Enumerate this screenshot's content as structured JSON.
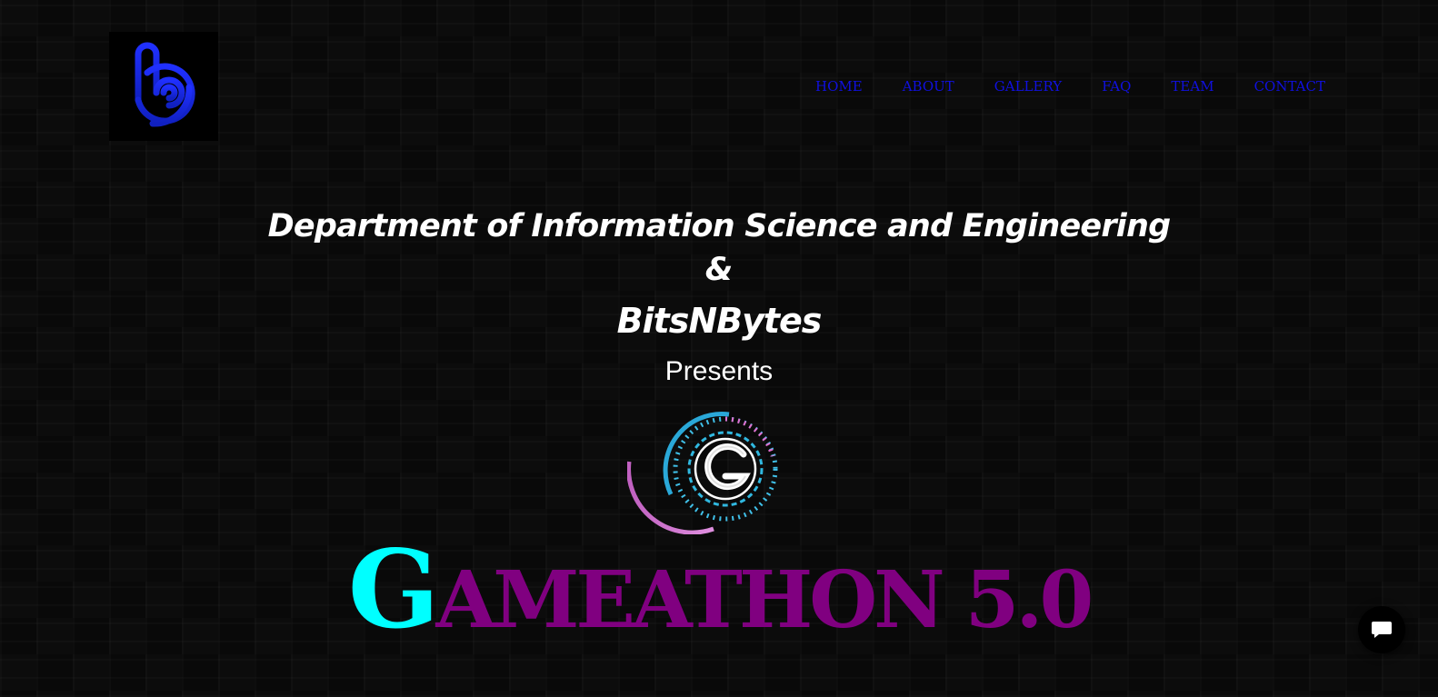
{
  "header": {
    "logo_icon": "fingerprint-b-logo-icon",
    "nav": [
      {
        "label": "HOME"
      },
      {
        "label": "ABOUT"
      },
      {
        "label": "GALLERY"
      },
      {
        "label": "FAQ"
      },
      {
        "label": "TEAM"
      },
      {
        "label": "CONTACT"
      }
    ]
  },
  "hero": {
    "department": "Department of Information Science and Engineering",
    "ampersand": "&",
    "club": "BitsNBytes",
    "presents": "Presents",
    "event_logo_icon": "gameathon-g-logo-icon",
    "title_first_letter": "G",
    "title_rest": "AMEATHON 5.0"
  },
  "chat": {
    "icon": "chat-bubble-icon"
  },
  "colors": {
    "nav_link": "#1010e0",
    "title_accent": "#00ffff",
    "title_main": "#800080",
    "logo_blue": "#1e2bff",
    "background": "#0c0c0c"
  }
}
